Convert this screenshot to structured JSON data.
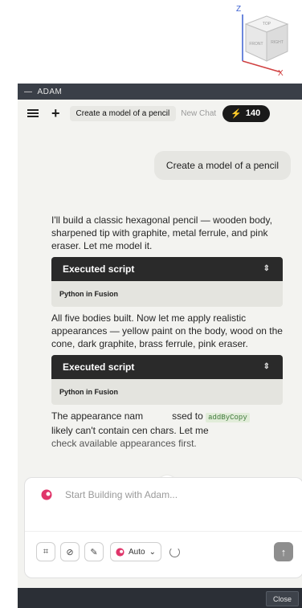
{
  "viewcube": {
    "z_label": "Z",
    "x_label": "X",
    "faces": [
      "TOP",
      "FRONT",
      "RIGHT"
    ]
  },
  "titlebar": {
    "title": "ADAM",
    "dash": "—"
  },
  "tabs": {
    "active": "Create a model of a pencil",
    "new_chat": "New Chat",
    "credits": "140"
  },
  "chat": {
    "user_message": "Create a model of a pencil",
    "assistant_intro": "I'll build a classic hexagonal pencil — wooden body, sharpened tip with graphite, metal ferrule, and pink eraser. Let me model it.",
    "script1": {
      "title": "Executed script",
      "subtitle": "Python in Fusion"
    },
    "assistant_mid": "All five bodies built. Now let me apply realistic appearances — yellow paint on the body, wood on the cone, dark graphite, brass ferrule, pink eraser.",
    "script2": {
      "title": "Executed script",
      "subtitle": "Python in Fusion"
    },
    "assistant_tail_a": "The appearance nam",
    "assistant_tail_b": "ssed to",
    "code_tag": "addByCopy",
    "assistant_tail_c": "likely can't contain ce",
    "assistant_tail_d": "n chars. Let me",
    "assistant_tail_e": "check available appearances first."
  },
  "composer": {
    "placeholder": "Start Building with Adam...",
    "model": "Auto"
  },
  "footer": {
    "close_label": "Close"
  }
}
